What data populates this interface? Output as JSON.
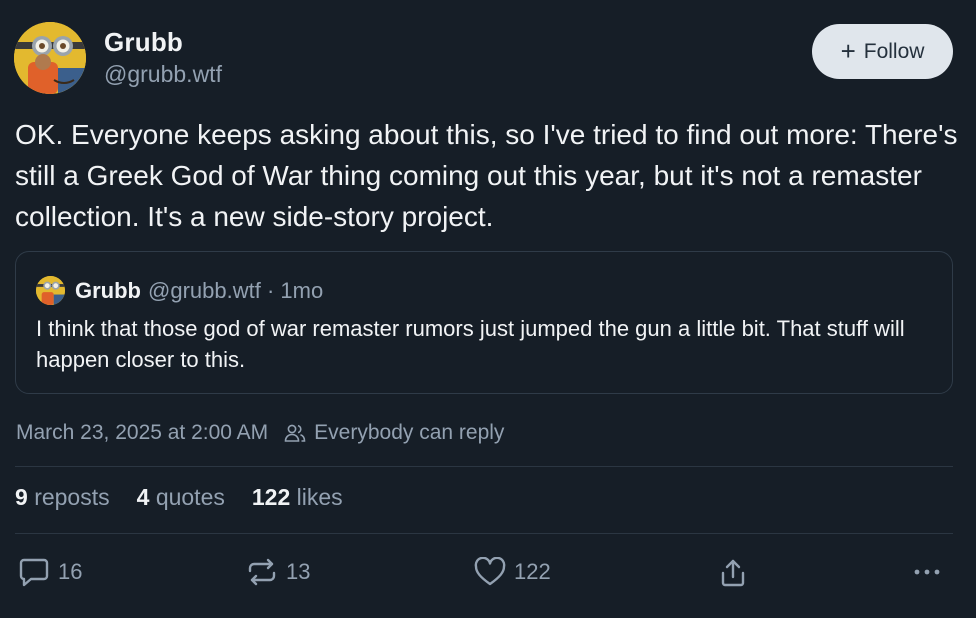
{
  "author": {
    "name": "Grubb",
    "handle": "@grubb.wtf",
    "avatar_icon": "minion-avatar-icon"
  },
  "follow_button": {
    "icon": "plus-icon",
    "label": "Follow"
  },
  "post": {
    "text": "OK. Everyone keeps asking about this, so I've tried to find out more: There's still a Greek God of War thing coming out this year, but it's not a remaster collection. It's a new side-story project."
  },
  "quote": {
    "name": "Grubb",
    "meta": "@grubb.wtf · 1mo",
    "text": "I think that those god of war remaster rumors just jumped the gun a little bit. That stuff will happen closer to this."
  },
  "meta": {
    "timestamp": "March 23, 2025 at 2:00 AM",
    "reply_setting": "Everybody can reply",
    "reply_icon": "people-icon"
  },
  "stats": {
    "reposts": {
      "count": "9",
      "label": "reposts"
    },
    "quotes": {
      "count": "4",
      "label": "quotes"
    },
    "likes": {
      "count": "122",
      "label": "likes"
    }
  },
  "actions": {
    "reply": {
      "icon": "reply-icon",
      "count": "16"
    },
    "repost": {
      "icon": "repost-icon",
      "count": "13"
    },
    "like": {
      "icon": "heart-icon",
      "count": "122"
    },
    "share": {
      "icon": "share-icon"
    },
    "more": {
      "icon": "more-icon"
    }
  },
  "colors": {
    "background": "#161e27",
    "text": "#f1f3f5",
    "muted": "#93a1b1",
    "follow_bg": "#e0e6ec",
    "border": "#2f3b48"
  }
}
